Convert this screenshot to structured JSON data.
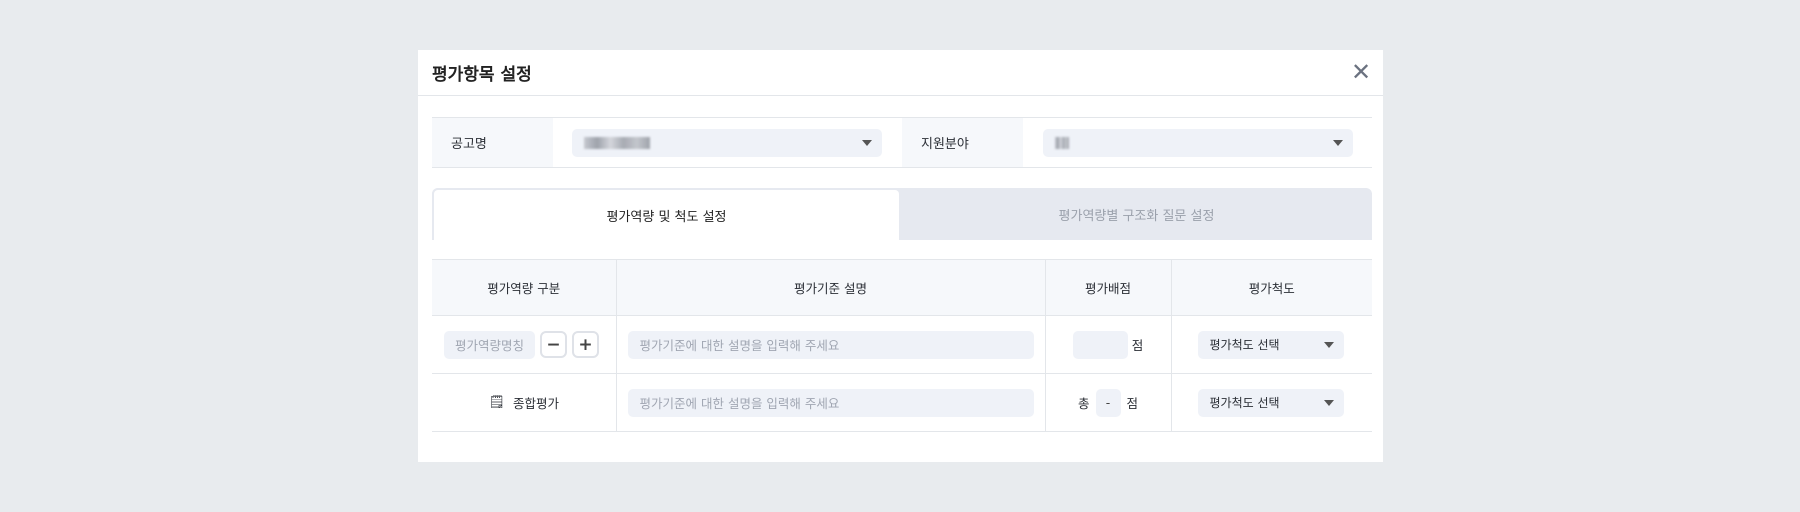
{
  "modal": {
    "title": "평가항목 설정",
    "close_icon": "close-icon"
  },
  "filter": {
    "notice_label": "공고명",
    "notice_value": "(blurred)",
    "field_label": "지원분야",
    "field_value": "(blurred)"
  },
  "tabs": [
    {
      "label": "평가역량 및 척도 설정",
      "active": true
    },
    {
      "label": "평가역량별 구조화 질문 설정",
      "active": false
    }
  ],
  "table": {
    "headers": [
      "평가역량 구분",
      "평가기준 설명",
      "평가배점",
      "평가척도"
    ],
    "row1": {
      "name_placeholder": "평가역량명칭",
      "minus": "−",
      "plus": "+",
      "desc_placeholder": "평가기준에 대한 설명을 입력해 주세요",
      "score_unit": "점",
      "scale": "평가척도 선택"
    },
    "row2": {
      "name": "종합평가",
      "desc_placeholder": "평가기준에 대한 설명을 입력해 주세요",
      "total_prefix": "총",
      "total_value": "-",
      "score_unit": "점",
      "scale": "평가척도 선택"
    }
  }
}
